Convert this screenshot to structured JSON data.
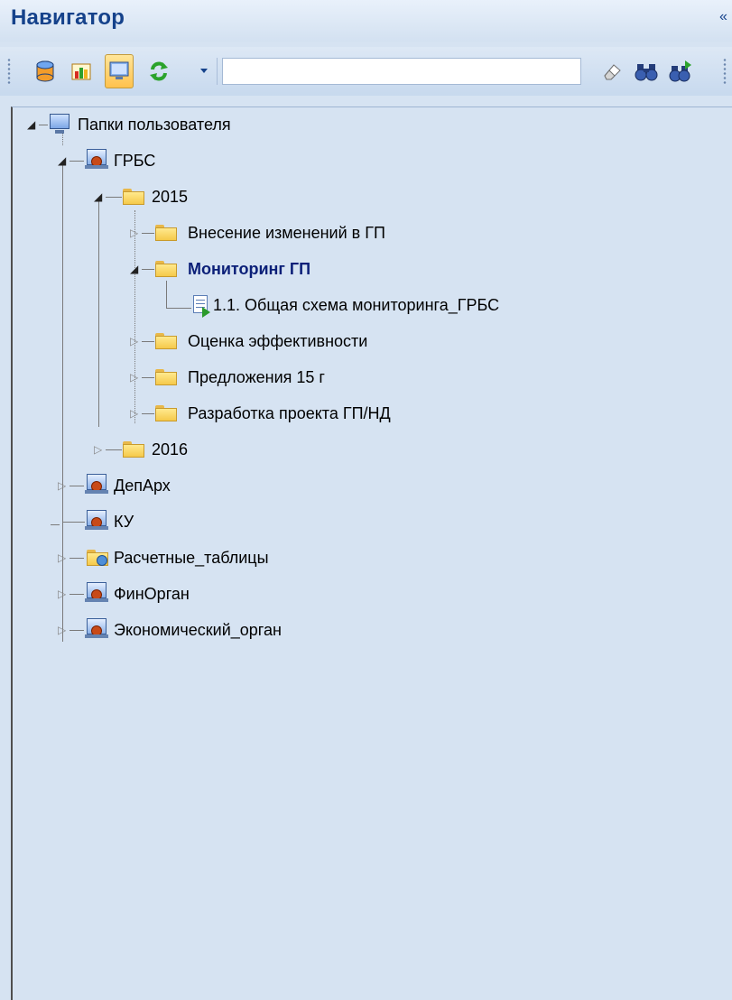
{
  "panel": {
    "title": "Навигатор",
    "collapse_glyph": "«"
  },
  "toolbar": {
    "buttons": [
      {
        "icon": "database-icon"
      },
      {
        "icon": "chart-icon"
      },
      {
        "icon": "monitor-icon",
        "active": true
      },
      {
        "icon": "refresh-icon"
      },
      {
        "icon": "dropdown-arrow-icon"
      }
    ],
    "search": {
      "value": "",
      "placeholder": ""
    },
    "right_icons": [
      "eraser-icon",
      "binoculars-icon",
      "binoculars-next-icon"
    ]
  },
  "tree": {
    "root": {
      "label": "Папки пользователя",
      "icon": "monitor-icon"
    },
    "nodes": [
      {
        "id": "grbs",
        "label": "ГРБС",
        "icon": "org-icon",
        "expanded": true
      },
      {
        "id": "y2015",
        "label": "2015",
        "icon": "folder-icon",
        "expanded": true
      },
      {
        "id": "vnesenie",
        "label": "Внесение изменений в ГП",
        "icon": "folder-icon",
        "expanded": false
      },
      {
        "id": "monitoring",
        "label": "Мониторинг ГП",
        "icon": "folder-icon",
        "expanded": true,
        "bold": true
      },
      {
        "id": "schema",
        "label": "1.1. Общая схема мониторинга_ГРБС",
        "icon": "document-icon"
      },
      {
        "id": "ocenka",
        "label": "Оценка эффективности",
        "icon": "folder-icon",
        "expanded": false
      },
      {
        "id": "predl",
        "label": "Предложения 15 г",
        "icon": "folder-icon",
        "expanded": false
      },
      {
        "id": "razrab",
        "label": "Разработка проекта ГП/НД",
        "icon": "folder-icon",
        "expanded": false
      },
      {
        "id": "y2016",
        "label": "2016",
        "icon": "folder-icon",
        "expanded": false
      },
      {
        "id": "deparh",
        "label": "ДепАрх",
        "icon": "org-icon",
        "expanded": false
      },
      {
        "id": "ku",
        "label": "КУ",
        "icon": "org-icon"
      },
      {
        "id": "raschet",
        "label": "Расчетные_таблицы",
        "icon": "user-folder-icon",
        "expanded": false
      },
      {
        "id": "finorgan",
        "label": "ФинОрган",
        "icon": "org-icon",
        "expanded": false
      },
      {
        "id": "econ",
        "label": "Экономический_орган",
        "icon": "org-icon",
        "expanded": false
      }
    ]
  }
}
